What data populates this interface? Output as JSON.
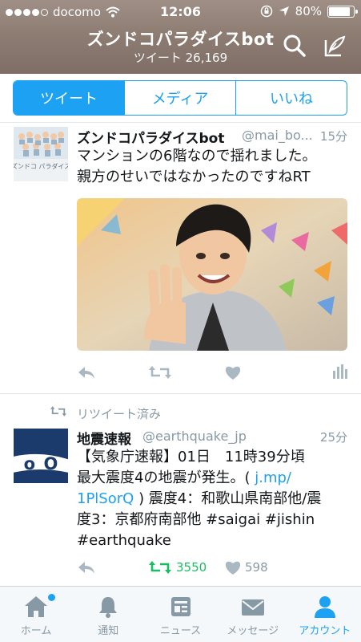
{
  "status_bar": {
    "carrier": "docomo",
    "time": "12:06",
    "battery": "80%",
    "signal_bars": 4
  },
  "header": {
    "title": "ズンドコパラダイスbot",
    "subtitle": "ツイート 26,169"
  },
  "segments": [
    {
      "label": "ツイート",
      "active": true
    },
    {
      "label": "メディア",
      "active": false
    },
    {
      "label": "いいね",
      "active": false
    }
  ],
  "tweets": [
    {
      "name": "ズンドコパラダイスbot",
      "handle": "@mai_bo...",
      "time": "15分",
      "text_lines": [
        "マンションの6階なので揺れました。",
        "親方のせいではなかったのですねRT"
      ],
      "avatar_caption": "ズンドコ パラダイス"
    },
    {
      "retweet_label": "リツイート済み",
      "name": "地震速報",
      "handle": "@earthquake_jp",
      "time": "25分",
      "line1": "【気象庁速報】01日　11時39分頃",
      "line2": "最大震度4の地震が発生。(",
      "link1": "j.mp/",
      "link2": "1PlSorQ",
      "line3_rest": ") 震度4：和歌山県南部他/震",
      "line4": "度3：京都府南部他 #saigai #jishin",
      "line5": "#earthquake",
      "avatar_text": "o_O",
      "retweets": "3550",
      "likes": "598"
    }
  ],
  "tab_bar": [
    {
      "label": "ホーム",
      "icon": "home-icon",
      "active": false,
      "badge": true
    },
    {
      "label": "通知",
      "icon": "bell-icon",
      "active": false
    },
    {
      "label": "ニュース",
      "icon": "news-icon",
      "active": false
    },
    {
      "label": "メッセージ",
      "icon": "envelope-icon",
      "active": false
    },
    {
      "label": "アカウント",
      "icon": "person-icon",
      "active": true
    }
  ],
  "colors": {
    "accent": "#1da1f2",
    "retweet_green": "#17bf63",
    "muted": "#8899a6"
  }
}
